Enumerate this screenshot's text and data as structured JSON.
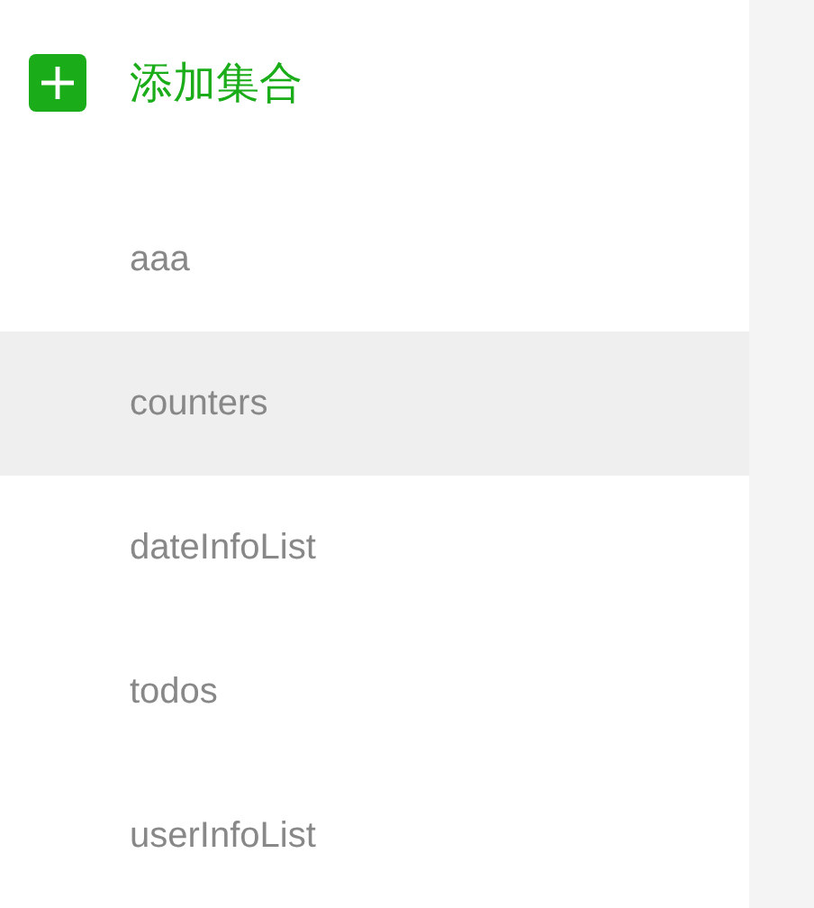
{
  "add_button": {
    "label": "添加集合"
  },
  "collections": [
    {
      "label": "aaa",
      "selected": false
    },
    {
      "label": "counters",
      "selected": true
    },
    {
      "label": "dateInfoList",
      "selected": false
    },
    {
      "label": "todos",
      "selected": false
    },
    {
      "label": "userInfoList",
      "selected": false
    }
  ]
}
